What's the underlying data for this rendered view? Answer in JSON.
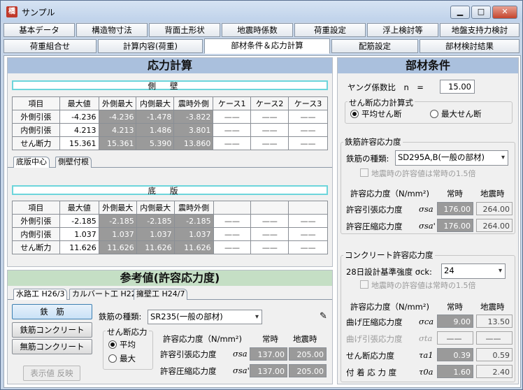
{
  "window": {
    "title": "サンプル",
    "icon_text": "橋",
    "min": "▁",
    "max": "□",
    "close": "✕"
  },
  "tabs_row1": [
    "基本データ",
    "構造物寸法",
    "背面土形状",
    "地震時係数",
    "荷重設定",
    "浮上検討等",
    "地盤支持力検討"
  ],
  "tabs_row2": [
    "荷重組合せ",
    "計算内容(荷重)",
    "部材条件＆応力計算",
    "配筋設定",
    "部材検討結果"
  ],
  "active_tab": "部材条件＆応力計算",
  "stress": {
    "header": "応力計算",
    "wall_label": "側壁",
    "wall_cols": [
      "項目",
      "最大値",
      "外側最大",
      "内側最大",
      "震時外側",
      "ケース1",
      "ケース2",
      "ケース3"
    ],
    "wall_rows": [
      {
        "name": "外側引張",
        "max": "-4.236",
        "a": "-4.236",
        "b": "-1.478",
        "c": "-3.822"
      },
      {
        "name": "内側引張",
        "max": "4.213",
        "a": "4.213",
        "b": "1.486",
        "c": "3.801"
      },
      {
        "name": "せん断力",
        "max": "15.361",
        "a": "15.361",
        "b": "5.390",
        "c": "13.860"
      }
    ],
    "dash": "——",
    "subtabs": [
      "底版中心",
      "側壁付根"
    ],
    "slab_label": "底版",
    "slab_cols": [
      "項目",
      "最大値",
      "外側最大",
      "内側最大",
      "震時外側",
      "",
      "",
      ""
    ],
    "slab_rows": [
      {
        "name": "外側引張",
        "max": "-2.185",
        "a": "-2.185",
        "b": "-2.185",
        "c": "-2.185"
      },
      {
        "name": "内側引張",
        "max": "1.037",
        "a": "1.037",
        "b": "1.037",
        "c": "1.037"
      },
      {
        "name": "せん断力",
        "max": "11.626",
        "a": "11.626",
        "b": "11.626",
        "c": "11.626"
      }
    ]
  },
  "reference": {
    "header": "参考値(許容応力度)",
    "subtabs": [
      "水路工 H26/3",
      "カルバート工 H22",
      "擁壁工 H24/7"
    ],
    "buttons": [
      "鉄　筋",
      "鉄筋コンクリート",
      "無筋コンクリート"
    ],
    "reflect_button": "表示値 反映",
    "rebar_type_label": "鉄筋の種類:",
    "rebar_type_value": "SR235(一般の部材)",
    "shear_group_title": "せん断応力",
    "shear_opts": [
      "平均",
      "最大"
    ],
    "allow_label": "許容応力度（N/mm²)",
    "normal": "常時",
    "seismic": "地震時",
    "rows": [
      {
        "name": "許容引張応力度",
        "sym": "σsa",
        "n": "137.00",
        "s": "205.00"
      },
      {
        "name": "許容圧縮応力度",
        "sym": "σsa'",
        "n": "137.00",
        "s": "205.00"
      }
    ]
  },
  "member": {
    "header": "部材条件",
    "young_label": "ヤング係数比　n　=",
    "young_value": "15.00",
    "shear_calc_title": "せん断応力計算式",
    "shear_opts": [
      "平均せん断",
      "最大せん断"
    ],
    "rebar_group": "鉄筋許容応力度",
    "rebar_type_label": "鉄筋の種類:",
    "rebar_type_value": "SD295A,B(一般の部材)",
    "seismic_check": "地震時の許容値は常時の1.5倍",
    "allow_label": "許容応力度（N/mm²)",
    "normal": "常時",
    "seismic": "地震時",
    "rebar_rows": [
      {
        "name": "許容引張応力度",
        "sym": "σsa",
        "n": "176.00",
        "s": "264.00"
      },
      {
        "name": "許容圧縮応力度",
        "sym": "σsa'",
        "n": "176.00",
        "s": "264.00"
      }
    ],
    "concrete_group": "コンクリート許容応力度",
    "design_strength_label": "28日設計基準強度 σck:",
    "design_strength_value": "24",
    "concrete_rows": [
      {
        "name": "曲げ圧縮応力度",
        "sym": "σca",
        "n": "9.00",
        "s": "13.50",
        "dim": false
      },
      {
        "name": "曲げ引張応力度",
        "sym": "σta",
        "n": "——",
        "s": "——",
        "dim": true
      },
      {
        "name": "せん断応力度",
        "sym": "τa1",
        "n": "0.39",
        "s": "0.59",
        "dim": false
      },
      {
        "name": "付 着 応 力 度",
        "sym": "τ0a",
        "n": "1.60",
        "s": "2.40",
        "dim": false
      }
    ]
  }
}
